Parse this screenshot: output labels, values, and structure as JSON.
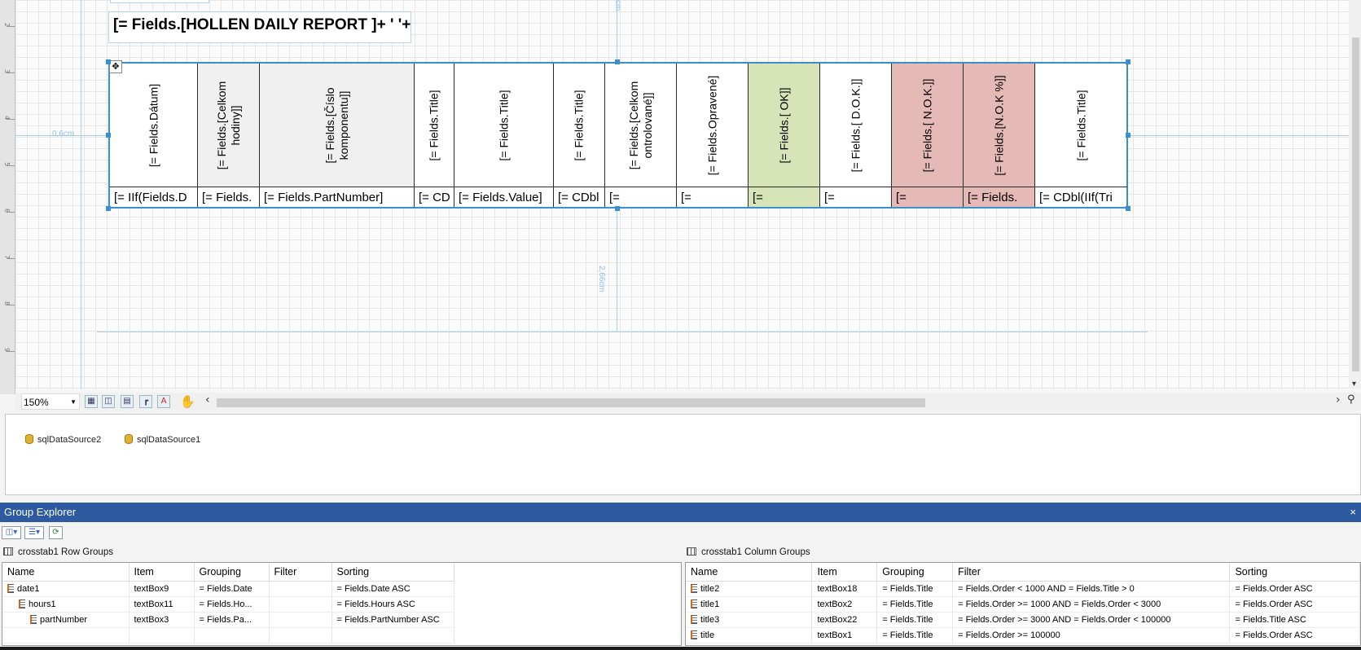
{
  "designer": {
    "header_expression": "[= Fields.[HOLLEN DAILY REPORT ]+ ' '+ F",
    "ruler_numbers": [
      "2",
      "3",
      "4",
      "5",
      "6",
      "7",
      "8",
      "9"
    ],
    "left_margin_label": "0,6cm",
    "height_label": "2,66cm",
    "top_label": "cm",
    "crosstab_headers": [
      "[= Fields.Dátum]",
      "[= Fields.[Celkom hodiny]]",
      "[= Fields.[Číslo komponentu]]",
      "[= Fields.Title]",
      "[= Fields.Title]",
      "[= Fields.Title]",
      "[= Fields.[Celkom ontrolované]]",
      "[= Fields.Opravené]",
      "[= Fields.[ OK]]",
      "[= Fields.[ D.O.K.]]",
      "[= Fields.[ N.O.K.]]",
      "[= Fields.[N.O.K %]]",
      "[= Fields.Title]"
    ],
    "crosstab_details": [
      "[= IIf(Fields.D",
      "[= Fields.",
      "[= Fields.PartNumber]",
      "[= CD",
      "[= Fields.Value]",
      "[= CDbl",
      "[=",
      "[=",
      "[=",
      "[=",
      "[=",
      "[= Fields.",
      "[= CDbl(IIf(Tri"
    ],
    "colors": {
      "selection": "#3a8fd0",
      "ok_green": "#d6e4b8",
      "nok_red": "#e5b9b6",
      "gray": "#f0f0f0"
    }
  },
  "statusbar": {
    "zoom": "150%"
  },
  "tray": {
    "datasources": [
      "sqlDataSource2",
      "sqlDataSource1"
    ]
  },
  "group_explorer": {
    "title": "Group Explorer",
    "close": "×",
    "row_groups": {
      "title": "crosstab1 Row Groups",
      "columns": [
        "Name",
        "Item",
        "Grouping",
        "Filter",
        "Sorting"
      ],
      "rows": [
        {
          "name": "date1",
          "item": "textBox9",
          "grouping": "= Fields.Date",
          "filter": "",
          "sorting": "= Fields.Date ASC"
        },
        {
          "name": "hours1",
          "item": "textBox11",
          "grouping": "= Fields.Ho...",
          "filter": "",
          "sorting": "= Fields.Hours ASC"
        },
        {
          "name": "partNumber",
          "item": "textBox3",
          "grouping": "= Fields.Pa...",
          "filter": "",
          "sorting": "= Fields.PartNumber ASC"
        }
      ]
    },
    "column_groups": {
      "title": "crosstab1 Column Groups",
      "columns": [
        "Name",
        "Item",
        "Grouping",
        "Filter",
        "Sorting"
      ],
      "rows": [
        {
          "name": "title2",
          "item": "textBox18",
          "grouping": "= Fields.Title",
          "filter": "= Fields.Order < 1000 AND = Fields.Title > 0",
          "sorting": "= Fields.Order ASC"
        },
        {
          "name": "title1",
          "item": "textBox2",
          "grouping": "= Fields.Title",
          "filter": "= Fields.Order >= 1000 AND = Fields.Order < 3000",
          "sorting": "= Fields.Order ASC"
        },
        {
          "name": "title3",
          "item": "textBox22",
          "grouping": "= Fields.Title",
          "filter": "= Fields.Order >= 3000 AND = Fields.Order < 100000",
          "sorting": "= Fields.Title ASC"
        },
        {
          "name": "title",
          "item": "textBox1",
          "grouping": "= Fields.Title",
          "filter": "= Fields.Order >= 100000",
          "sorting": "= Fields.Order ASC"
        }
      ]
    }
  }
}
